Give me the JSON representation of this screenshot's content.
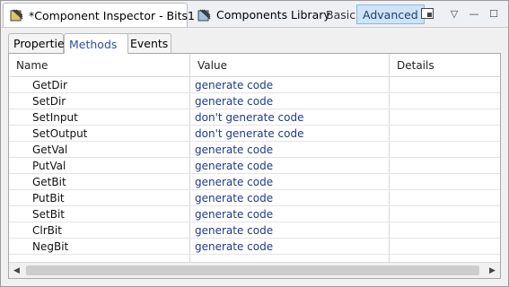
{
  "viewbar": {
    "active_tab": {
      "label": "*Component Inspector - Bits1",
      "icon": "component-inspector-icon",
      "close": "⊠"
    },
    "library_tab": {
      "label": "Components Library",
      "icon": "components-library-icon"
    },
    "basic_label": "Basic",
    "advanced_label": "Advanced",
    "controls": {
      "view_menu": "▽",
      "minimize": "—",
      "maximize": "☐"
    }
  },
  "inner_tabs": {
    "properties": "Properties",
    "methods": "Methods",
    "events": "Events"
  },
  "table": {
    "headers": {
      "name": "Name",
      "value": "Value",
      "details": "Details"
    },
    "rows": [
      {
        "name": "GetDir",
        "value": "generate code"
      },
      {
        "name": "SetDir",
        "value": "generate code"
      },
      {
        "name": "SetInput",
        "value": "don't generate code"
      },
      {
        "name": "SetOutput",
        "value": "don't generate code"
      },
      {
        "name": "GetVal",
        "value": "generate code"
      },
      {
        "name": "PutVal",
        "value": "generate code"
      },
      {
        "name": "GetBit",
        "value": "generate code"
      },
      {
        "name": "PutBit",
        "value": "generate code"
      },
      {
        "name": "SetBit",
        "value": "generate code"
      },
      {
        "name": "ClrBit",
        "value": "generate code"
      },
      {
        "name": "NegBit",
        "value": "generate code"
      }
    ]
  },
  "scrollbar": {
    "left_arrow": "◀",
    "right_arrow": "▶"
  },
  "colors": {
    "accent": "#2c4fa5",
    "value_text": "#1f3a8e",
    "advanced_bg": "#cfe3f7"
  }
}
